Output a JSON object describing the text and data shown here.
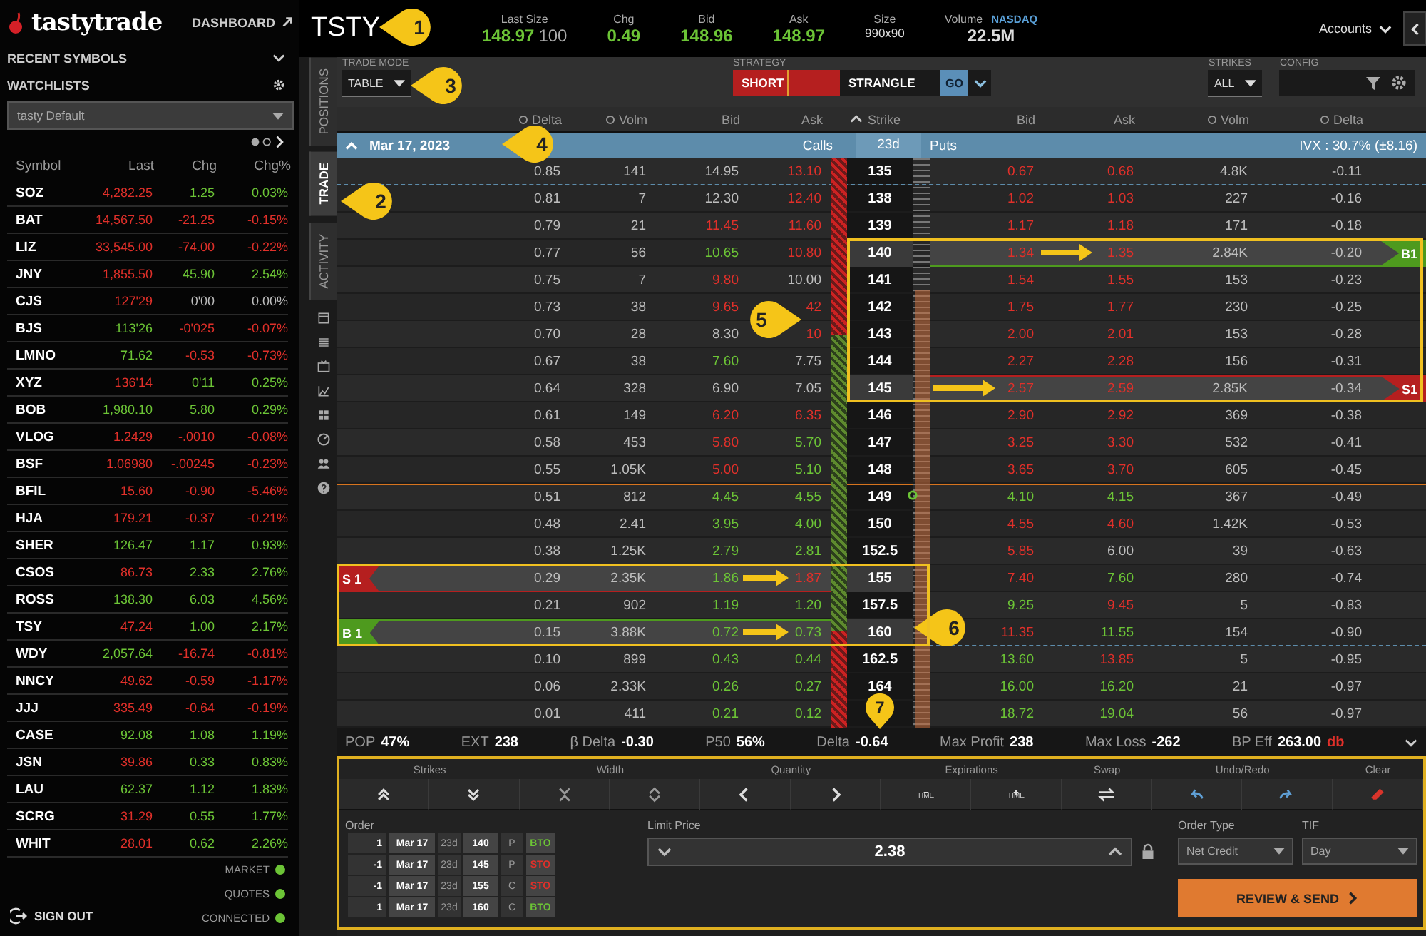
{
  "sidebar": {
    "logo": "tastytrade",
    "dashboard": "DASHBOARD",
    "recent_symbols": "RECENT SYMBOLS",
    "watchlists": "WATCHLISTS",
    "watchlist_select": "tasty Default",
    "columns": [
      "Symbol",
      "Last",
      "Chg",
      "Chg%"
    ],
    "rows": [
      {
        "symbol": "SOZ",
        "values": [
          {
            "text": "4,282.25",
            "color": "#e0302a"
          },
          {
            "text": "1.25",
            "color": "#6cc436"
          },
          {
            "text": "0.03%",
            "color": "#6cc436"
          }
        ]
      },
      {
        "symbol": "BAT",
        "values": [
          {
            "text": "14,567.50",
            "color": "#e0302a"
          },
          {
            "text": "-21.25",
            "color": "#e0302a"
          },
          {
            "text": "-0.15%",
            "color": "#e0302a"
          }
        ]
      },
      {
        "symbol": "LIZ",
        "values": [
          {
            "text": "33,545.00",
            "color": "#e0302a"
          },
          {
            "text": "-74.00",
            "color": "#e0302a"
          },
          {
            "text": "-0.22%",
            "color": "#e0302a"
          }
        ]
      },
      {
        "symbol": "JNY",
        "values": [
          {
            "text": "1,855.50",
            "color": "#e0302a"
          },
          {
            "text": "45.90",
            "color": "#6cc436"
          },
          {
            "text": "2.54%",
            "color": "#6cc436"
          }
        ]
      },
      {
        "symbol": "CJS",
        "values": [
          {
            "text": "127'29",
            "color": "#e0302a"
          },
          {
            "text": "0'00",
            "color": "#bdbdbd"
          },
          {
            "text": "0.00%",
            "color": "#bdbdbd"
          }
        ]
      },
      {
        "symbol": "BJS",
        "values": [
          {
            "text": "113'26",
            "color": "#6cc436"
          },
          {
            "text": "-0'025",
            "color": "#e0302a"
          },
          {
            "text": "-0.07%",
            "color": "#e0302a"
          }
        ]
      },
      {
        "symbol": "LMNO",
        "values": [
          {
            "text": "71.62",
            "color": "#6cc436"
          },
          {
            "text": "-0.53",
            "color": "#e0302a"
          },
          {
            "text": "-0.73%",
            "color": "#e0302a"
          }
        ]
      },
      {
        "symbol": "XYZ",
        "values": [
          {
            "text": "136'14",
            "color": "#e0302a"
          },
          {
            "text": "0'11",
            "color": "#6cc436"
          },
          {
            "text": "0.25%",
            "color": "#6cc436"
          }
        ]
      },
      {
        "symbol": "BOB",
        "values": [
          {
            "text": "1,980.10",
            "color": "#6cc436"
          },
          {
            "text": "5.80",
            "color": "#6cc436"
          },
          {
            "text": "0.29%",
            "color": "#6cc436"
          }
        ]
      },
      {
        "symbol": "VLOG",
        "values": [
          {
            "text": "1.2429",
            "color": "#e0302a"
          },
          {
            "text": "-.0010",
            "color": "#e0302a"
          },
          {
            "text": "-0.08%",
            "color": "#e0302a"
          }
        ]
      },
      {
        "symbol": "BSF",
        "values": [
          {
            "text": "1.06980",
            "color": "#e0302a"
          },
          {
            "text": "-.00245",
            "color": "#e0302a"
          },
          {
            "text": "-0.23%",
            "color": "#e0302a"
          }
        ]
      },
      {
        "symbol": "BFIL",
        "values": [
          {
            "text": "15.60",
            "color": "#e0302a"
          },
          {
            "text": "-0.90",
            "color": "#e0302a"
          },
          {
            "text": "-5.46%",
            "color": "#e0302a"
          }
        ]
      },
      {
        "symbol": "HJA",
        "values": [
          {
            "text": "179.21",
            "color": "#e0302a"
          },
          {
            "text": "-0.37",
            "color": "#e0302a"
          },
          {
            "text": "-0.21%",
            "color": "#e0302a"
          }
        ]
      },
      {
        "symbol": "SHER",
        "values": [
          {
            "text": "126.47",
            "color": "#6cc436"
          },
          {
            "text": "1.17",
            "color": "#6cc436"
          },
          {
            "text": "0.93%",
            "color": "#6cc436"
          }
        ]
      },
      {
        "symbol": "CSOS",
        "values": [
          {
            "text": "86.73",
            "color": "#e0302a"
          },
          {
            "text": "2.33",
            "color": "#6cc436"
          },
          {
            "text": "2.76%",
            "color": "#6cc436"
          }
        ]
      },
      {
        "symbol": "ROSS",
        "values": [
          {
            "text": "138.30",
            "color": "#6cc436"
          },
          {
            "text": "6.03",
            "color": "#6cc436"
          },
          {
            "text": "4.56%",
            "color": "#6cc436"
          }
        ]
      },
      {
        "symbol": "TSY",
        "values": [
          {
            "text": "47.24",
            "color": "#e0302a"
          },
          {
            "text": "1.00",
            "color": "#6cc436"
          },
          {
            "text": "2.17%",
            "color": "#6cc436"
          }
        ]
      },
      {
        "symbol": "WDY",
        "values": [
          {
            "text": "2,057.64",
            "color": "#6cc436"
          },
          {
            "text": "-16.74",
            "color": "#e0302a"
          },
          {
            "text": "-0.81%",
            "color": "#e0302a"
          }
        ]
      },
      {
        "symbol": "NNCY",
        "values": [
          {
            "text": "49.62",
            "color": "#e0302a"
          },
          {
            "text": "-0.59",
            "color": "#e0302a"
          },
          {
            "text": "-1.17%",
            "color": "#e0302a"
          }
        ]
      },
      {
        "symbol": "JJJ",
        "values": [
          {
            "text": "335.49",
            "color": "#e0302a"
          },
          {
            "text": "-0.64",
            "color": "#e0302a"
          },
          {
            "text": "-0.19%",
            "color": "#e0302a"
          }
        ]
      },
      {
        "symbol": "CASE",
        "values": [
          {
            "text": "92.08",
            "color": "#6cc436"
          },
          {
            "text": "1.08",
            "color": "#6cc436"
          },
          {
            "text": "1.19%",
            "color": "#6cc436"
          }
        ]
      },
      {
        "symbol": "JSN",
        "values": [
          {
            "text": "39.86",
            "color": "#e0302a"
          },
          {
            "text": "0.33",
            "color": "#6cc436"
          },
          {
            "text": "0.83%",
            "color": "#6cc436"
          }
        ]
      },
      {
        "symbol": "LAU",
        "values": [
          {
            "text": "62.37",
            "color": "#6cc436"
          },
          {
            "text": "1.12",
            "color": "#6cc436"
          },
          {
            "text": "1.83%",
            "color": "#6cc436"
          }
        ]
      },
      {
        "symbol": "SCRG",
        "values": [
          {
            "text": "31.29",
            "color": "#e0302a"
          },
          {
            "text": "0.55",
            "color": "#6cc436"
          },
          {
            "text": "1.77%",
            "color": "#6cc436"
          }
        ]
      },
      {
        "symbol": "WHIT",
        "values": [
          {
            "text": "28.01",
            "color": "#e0302a"
          },
          {
            "text": "0.62",
            "color": "#6cc436"
          },
          {
            "text": "2.26%",
            "color": "#6cc436"
          }
        ]
      }
    ],
    "status": [
      {
        "label": "MARKET",
        "on": true
      },
      {
        "label": "QUOTES",
        "on": true
      },
      {
        "label": "CONNECTED",
        "on": true
      }
    ],
    "sign_out": "SIGN OUT"
  },
  "header": {
    "symbol": "TSTY",
    "quotes": [
      {
        "label": "Last Size",
        "value": "148.97",
        "color": "#6cc436",
        "extra": "100"
      },
      {
        "label": "Chg",
        "value": "0.49",
        "color": "#6cc436"
      },
      {
        "label": "Bid",
        "value": "148.96",
        "color": "#6cc436"
      },
      {
        "label": "Ask",
        "value": "148.97",
        "color": "#6cc436"
      },
      {
        "label": "Size",
        "value": "990x90",
        "color": "#dddddd",
        "kind": "compact"
      },
      {
        "label": "Volume",
        "value": "22.5M",
        "color": "#dddddd",
        "exchange": "NASDAQ"
      }
    ],
    "accounts": "Accounts"
  },
  "side_tabs": [
    {
      "label": "POSITIONS",
      "selected": false
    },
    {
      "label": "TRADE",
      "selected": true
    },
    {
      "label": "ACTIVITY",
      "selected": false
    }
  ],
  "toolbar": {
    "trade_mode_label": "TRADE MODE",
    "trade_mode": "TABLE",
    "strategy_label": "STRATEGY",
    "strategy_side": "SHORT",
    "strategy": "STRANGLE",
    "go": "GO",
    "strikes_label": "STRIKES",
    "strikes": "ALL",
    "config_label": "CONFIG"
  },
  "chain": {
    "call_columns": [
      "Delta",
      "Volm",
      "Bid",
      "Ask"
    ],
    "strike_column": "Strike",
    "put_columns": [
      "Bid",
      "Ask",
      "Volm",
      "Delta"
    ],
    "expiration": {
      "date": "Mar 17, 2023",
      "calls": "Calls",
      "dte": "23d",
      "puts": "Puts",
      "ivx": "IVX : 30.7% (±8.16)",
      "expanded": true
    },
    "rows": [
      {
        "call": {
          "delta": "0.85",
          "volm": "141",
          "bid": {
            "text": "14.95",
            "color": "#bdbdbd"
          },
          "ask": {
            "text": "13.10",
            "color": "#e0302a"
          }
        },
        "strike": "135",
        "put": {
          "bid": {
            "text": "0.67",
            "color": "#e0302a"
          },
          "ask": {
            "text": "0.68",
            "color": "#e0302a"
          },
          "volm": "4.8K",
          "delta": "-0.11"
        },
        "dashed_below": true
      },
      {
        "call": {
          "delta": "0.81",
          "volm": "7",
          "bid": {
            "text": "12.30",
            "color": "#bdbdbd"
          },
          "ask": {
            "text": "12.40",
            "color": "#e0302a"
          }
        },
        "strike": "138",
        "put": {
          "bid": {
            "text": "1.02",
            "color": "#e0302a"
          },
          "ask": {
            "text": "1.03",
            "color": "#e0302a"
          },
          "volm": "227",
          "delta": "-0.16"
        }
      },
      {
        "call": {
          "delta": "0.79",
          "volm": "21",
          "bid": {
            "text": "11.45",
            "color": "#e0302a"
          },
          "ask": {
            "text": "11.60",
            "color": "#e0302a"
          }
        },
        "strike": "139",
        "put": {
          "bid": {
            "text": "1.17",
            "color": "#e0302a"
          },
          "ask": {
            "text": "1.18",
            "color": "#e0302a"
          },
          "volm": "171",
          "delta": "-0.18"
        }
      },
      {
        "call": {
          "delta": "0.77",
          "volm": "56",
          "bid": {
            "text": "10.65",
            "color": "#6cc436"
          },
          "ask": {
            "text": "10.80",
            "color": "#e0302a"
          }
        },
        "strike": "140",
        "put": {
          "bid": {
            "text": "1.34",
            "color": "#e0302a"
          },
          "ask": {
            "text": "1.35",
            "color": "#e0302a"
          },
          "volm": "2.84K",
          "delta": "-0.20"
        },
        "put_leg": {
          "label": "B1",
          "kind": "buy"
        },
        "boxed_puts": true,
        "arrow": {
          "kind": "put"
        }
      },
      {
        "call": {
          "delta": "0.75",
          "volm": "7",
          "bid": {
            "text": "9.80",
            "color": "#e0302a"
          },
          "ask": {
            "text": "10.00",
            "color": "#bdbdbd"
          }
        },
        "strike": "141",
        "put": {
          "bid": {
            "text": "1.54",
            "color": "#e0302a"
          },
          "ask": {
            "text": "1.55",
            "color": "#e0302a"
          },
          "volm": "153",
          "delta": "-0.23"
        },
        "boxed_puts": true
      },
      {
        "call": {
          "delta": "0.73",
          "volm": "38",
          "bid": {
            "text": "9.65",
            "color": "#e0302a"
          },
          "ask": {
            "text": "42",
            "color": "#e0302a"
          }
        },
        "strike": "142",
        "put": {
          "bid": {
            "text": "1.75",
            "color": "#e0302a"
          },
          "ask": {
            "text": "1.77",
            "color": "#e0302a"
          },
          "volm": "230",
          "delta": "-0.25"
        },
        "boxed_puts": true
      },
      {
        "call": {
          "delta": "0.70",
          "volm": "28",
          "bid": {
            "text": "8.30",
            "color": "#bdbdbd"
          },
          "ask": {
            "text": "10",
            "color": "#e0302a"
          }
        },
        "strike": "143",
        "put": {
          "bid": {
            "text": "2.00",
            "color": "#e0302a"
          },
          "ask": {
            "text": "2.01",
            "color": "#e0302a"
          },
          "volm": "153",
          "delta": "-0.28"
        },
        "boxed_puts": true
      },
      {
        "call": {
          "delta": "0.67",
          "volm": "38",
          "bid": {
            "text": "7.60",
            "color": "#6cc436"
          },
          "ask": {
            "text": "7.75",
            "color": "#bdbdbd"
          }
        },
        "strike": "144",
        "put": {
          "bid": {
            "text": "2.27",
            "color": "#e0302a"
          },
          "ask": {
            "text": "2.28",
            "color": "#e0302a"
          },
          "volm": "156",
          "delta": "-0.31"
        },
        "boxed_puts": true
      },
      {
        "call": {
          "delta": "0.64",
          "volm": "328",
          "bid": {
            "text": "6.90",
            "color": "#bdbdbd"
          },
          "ask": {
            "text": "7.05",
            "color": "#bdbdbd"
          }
        },
        "strike": "145",
        "put": {
          "bid": {
            "text": "2.57",
            "color": "#e0302a"
          },
          "ask": {
            "text": "2.59",
            "color": "#e0302a"
          },
          "volm": "2.85K",
          "delta": "-0.34"
        },
        "put_leg": {
          "label": "S1",
          "kind": "sell"
        },
        "boxed_puts": true,
        "arrow": {
          "kind": "ruler"
        }
      },
      {
        "call": {
          "delta": "0.61",
          "volm": "149",
          "bid": {
            "text": "6.20",
            "color": "#e0302a"
          },
          "ask": {
            "text": "6.35",
            "color": "#e0302a"
          }
        },
        "strike": "146",
        "put": {
          "bid": {
            "text": "2.90",
            "color": "#e0302a"
          },
          "ask": {
            "text": "2.92",
            "color": "#e0302a"
          },
          "volm": "369",
          "delta": "-0.38"
        }
      },
      {
        "call": {
          "delta": "0.58",
          "volm": "453",
          "bid": {
            "text": "5.80",
            "color": "#e0302a"
          },
          "ask": {
            "text": "5.70",
            "color": "#6cc436"
          }
        },
        "strike": "147",
        "put": {
          "bid": {
            "text": "3.25",
            "color": "#e0302a"
          },
          "ask": {
            "text": "3.30",
            "color": "#e0302a"
          },
          "volm": "532",
          "delta": "-0.41"
        }
      },
      {
        "call": {
          "delta": "0.55",
          "volm": "1.05K",
          "bid": {
            "text": "5.00",
            "color": "#e0302a"
          },
          "ask": {
            "text": "5.10",
            "color": "#6cc436"
          }
        },
        "strike": "148",
        "put": {
          "bid": {
            "text": "3.65",
            "color": "#e0302a"
          },
          "ask": {
            "text": "3.70",
            "color": "#e0302a"
          },
          "volm": "605",
          "delta": "-0.45"
        }
      },
      {
        "call": {
          "delta": "0.51",
          "volm": "812",
          "bid": {
            "text": "4.45",
            "color": "#6cc436"
          },
          "ask": {
            "text": "4.55",
            "color": "#6cc436"
          }
        },
        "strike": "149",
        "put": {
          "bid": {
            "text": "4.10",
            "color": "#6cc436"
          },
          "ask": {
            "text": "4.15",
            "color": "#6cc436"
          },
          "volm": "367",
          "delta": "-0.49"
        },
        "atm": true
      },
      {
        "call": {
          "delta": "0.48",
          "volm": "2.41",
          "bid": {
            "text": "3.95",
            "color": "#6cc436"
          },
          "ask": {
            "text": "4.00",
            "color": "#6cc436"
          }
        },
        "strike": "150",
        "put": {
          "bid": {
            "text": "4.55",
            "color": "#e0302a"
          },
          "ask": {
            "text": "4.60",
            "color": "#e0302a"
          },
          "volm": "1.42K",
          "delta": "-0.53"
        }
      },
      {
        "call": {
          "delta": "0.38",
          "volm": "1.25K",
          "bid": {
            "text": "2.79",
            "color": "#6cc436"
          },
          "ask": {
            "text": "2.81",
            "color": "#6cc436"
          }
        },
        "strike": "152.5",
        "put": {
          "bid": {
            "text": "5.85",
            "color": "#e0302a"
          },
          "ask": {
            "text": "6.00",
            "color": "#bdbdbd"
          },
          "volm": "39",
          "delta": "-0.63"
        }
      },
      {
        "call": {
          "delta": "0.29",
          "volm": "2.35K",
          "bid": {
            "text": "1.86",
            "color": "#6cc436"
          },
          "ask": {
            "text": "1.87",
            "color": "#e0302a"
          }
        },
        "strike": "155",
        "put": {
          "bid": {
            "text": "7.40",
            "color": "#e0302a"
          },
          "ask": {
            "text": "7.60",
            "color": "#6cc436"
          },
          "volm": "280",
          "delta": "-0.74"
        },
        "call_leg": {
          "label": "S 1",
          "kind": "sell"
        },
        "boxed_calls": true,
        "arrow": {
          "kind": "call"
        }
      },
      {
        "call": {
          "delta": "0.21",
          "volm": "902",
          "bid": {
            "text": "1.19",
            "color": "#6cc436"
          },
          "ask": {
            "text": "1.20",
            "color": "#6cc436"
          }
        },
        "strike": "157.5",
        "put": {
          "bid": {
            "text": "9.25",
            "color": "#6cc436"
          },
          "ask": {
            "text": "9.45",
            "color": "#e0302a"
          },
          "volm": "5",
          "delta": "-0.83"
        },
        "boxed_calls": true
      },
      {
        "call": {
          "delta": "0.15",
          "volm": "3.88K",
          "bid": {
            "text": "0.72",
            "color": "#6cc436"
          },
          "ask": {
            "text": "0.73",
            "color": "#6cc436"
          }
        },
        "strike": "160",
        "put": {
          "bid": {
            "text": "11.35",
            "color": "#e0302a"
          },
          "ask": {
            "text": "11.55",
            "color": "#6cc436"
          },
          "volm": "154",
          "delta": "-0.90"
        },
        "call_leg": {
          "label": "B 1",
          "kind": "buy"
        },
        "boxed_calls": true,
        "arrow": {
          "kind": "call"
        },
        "dashed_below": true
      },
      {
        "call": {
          "delta": "0.10",
          "volm": "899",
          "bid": {
            "text": "0.43",
            "color": "#6cc436"
          },
          "ask": {
            "text": "0.44",
            "color": "#6cc436"
          }
        },
        "strike": "162.5",
        "put": {
          "bid": {
            "text": "13.60",
            "color": "#6cc436"
          },
          "ask": {
            "text": "13.85",
            "color": "#e0302a"
          },
          "volm": "5",
          "delta": "-0.95"
        }
      },
      {
        "call": {
          "delta": "0.06",
          "volm": "2.33K",
          "bid": {
            "text": "0.26",
            "color": "#6cc436"
          },
          "ask": {
            "text": "0.27",
            "color": "#6cc436"
          }
        },
        "strike": "164",
        "put": {
          "bid": {
            "text": "16.00",
            "color": "#6cc436"
          },
          "ask": {
            "text": "16.20",
            "color": "#6cc436"
          },
          "volm": "21",
          "delta": "-0.97"
        }
      },
      {
        "call": {
          "delta": "0.01",
          "volm": "411",
          "bid": {
            "text": "0.21",
            "color": "#6cc436"
          },
          "ask": {
            "text": "0.12",
            "color": "#6cc436"
          }
        },
        "put": {
          "bid": {
            "text": "18.72",
            "color": "#6cc436"
          },
          "ask": {
            "text": "19.04",
            "color": "#6cc436"
          },
          "volm": "56",
          "delta": "-0.97"
        }
      }
    ]
  },
  "stats": [
    {
      "label": "POP",
      "value": "47%"
    },
    {
      "label": "EXT",
      "value": "238"
    },
    {
      "label": "β Delta",
      "value": "-0.30"
    },
    {
      "label": "P50",
      "value": "56%"
    },
    {
      "label": "Delta",
      "value": "-0.64"
    },
    {
      "label": "Max Profit",
      "value": "238"
    },
    {
      "label": "Max Loss",
      "value": "-262"
    },
    {
      "label": "BP Eff",
      "value": "263.00",
      "suffix": "db"
    }
  ],
  "controls": [
    {
      "label": "Strikes",
      "buttons": [
        {
          "kind": "up"
        },
        {
          "kind": "down"
        }
      ]
    },
    {
      "label": "Width",
      "buttons": [
        {
          "kind": "narrow"
        },
        {
          "kind": "widen"
        }
      ]
    },
    {
      "label": "Quantity",
      "buttons": [
        {
          "kind": "less"
        },
        {
          "kind": "more"
        }
      ]
    },
    {
      "label": "Expirations",
      "buttons": [
        {
          "kind": "earlier",
          "text": "TIME"
        },
        {
          "kind": "later",
          "text": "TIME"
        }
      ]
    },
    {
      "label": "Swap",
      "buttons": [
        {
          "kind": "swap"
        }
      ]
    },
    {
      "label": "Undo/Redo",
      "buttons": [
        {
          "kind": "undo"
        },
        {
          "kind": "redo"
        }
      ]
    },
    {
      "label": "Clear",
      "buttons": [
        {
          "kind": "clear"
        }
      ]
    }
  ],
  "order": {
    "label": "Order",
    "legs": [
      {
        "qty": "1",
        "date": "Mar 17",
        "dte": "23d",
        "strike": "140",
        "type": "P",
        "action": "BTO",
        "kind": "buy"
      },
      {
        "qty": "-1",
        "date": "Mar 17",
        "dte": "23d",
        "strike": "145",
        "type": "P",
        "action": "STO",
        "kind": "sell"
      },
      {
        "qty": "-1",
        "date": "Mar 17",
        "dte": "23d",
        "strike": "155",
        "type": "C",
        "action": "STO",
        "kind": "sell"
      },
      {
        "qty": "1",
        "date": "Mar 17",
        "dte": "23d",
        "strike": "160",
        "type": "C",
        "action": "BTO",
        "kind": "buy"
      }
    ],
    "limit_label": "Limit Price",
    "limit": "2.38",
    "order_type_label": "Order Type",
    "order_type": "Net Credit",
    "tif_label": "TIF",
    "tif": "Day",
    "submit": "REVIEW & SEND"
  },
  "callouts": [
    {
      "label": "1"
    },
    {
      "label": "2"
    },
    {
      "label": "3"
    },
    {
      "label": "4"
    },
    {
      "label": "5"
    },
    {
      "label": "6"
    },
    {
      "label": "7"
    }
  ]
}
